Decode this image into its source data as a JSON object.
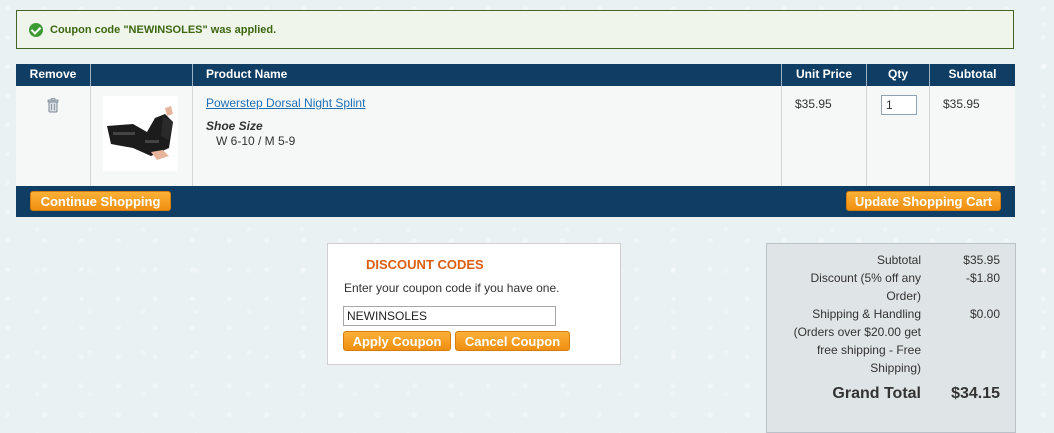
{
  "message": {
    "text": "Coupon code \"NEWINSOLES\" was applied."
  },
  "cart": {
    "headers": {
      "remove": "Remove",
      "image": "",
      "product_name": "Product Name",
      "unit_price": "Unit Price",
      "qty": "Qty",
      "subtotal": "Subtotal"
    },
    "items": [
      {
        "name": "Powerstep Dorsal Night Splint",
        "option_label": "Shoe Size",
        "option_value": "W 6-10 / M 5-9",
        "unit_price": "$35.95",
        "qty": "1",
        "subtotal": "$35.95"
      }
    ],
    "continue_label": "Continue Shopping",
    "update_label": "Update Shopping Cart"
  },
  "discount": {
    "title": "DISCOUNT CODES",
    "help": "Enter your coupon code if you have one.",
    "code_value": "NEWINSOLES",
    "apply_label": "Apply Coupon",
    "cancel_label": "Cancel Coupon"
  },
  "totals": {
    "subtotal_label": "Subtotal",
    "subtotal_value": "$35.95",
    "discount_label_1": "Discount (5% off any",
    "discount_label_2": "Order)",
    "discount_value": "-$1.80",
    "shipping_label_1": "Shipping & Handling",
    "shipping_label_2": "(Orders over $20.00 get",
    "shipping_label_3": "free shipping - Free",
    "shipping_label_4": "Shipping)",
    "shipping_value": "$0.00",
    "grand_total_label": "Grand Total",
    "grand_total_value": "$34.15"
  },
  "colors": {
    "header_bg": "#0f3d63",
    "button_orange": "#f39a1a",
    "discount_title": "#db5e11",
    "link": "#1f6fb4",
    "success_green": "#3d9b35"
  },
  "icons": {
    "success": "check-circle-icon",
    "remove": "trash-icon"
  }
}
